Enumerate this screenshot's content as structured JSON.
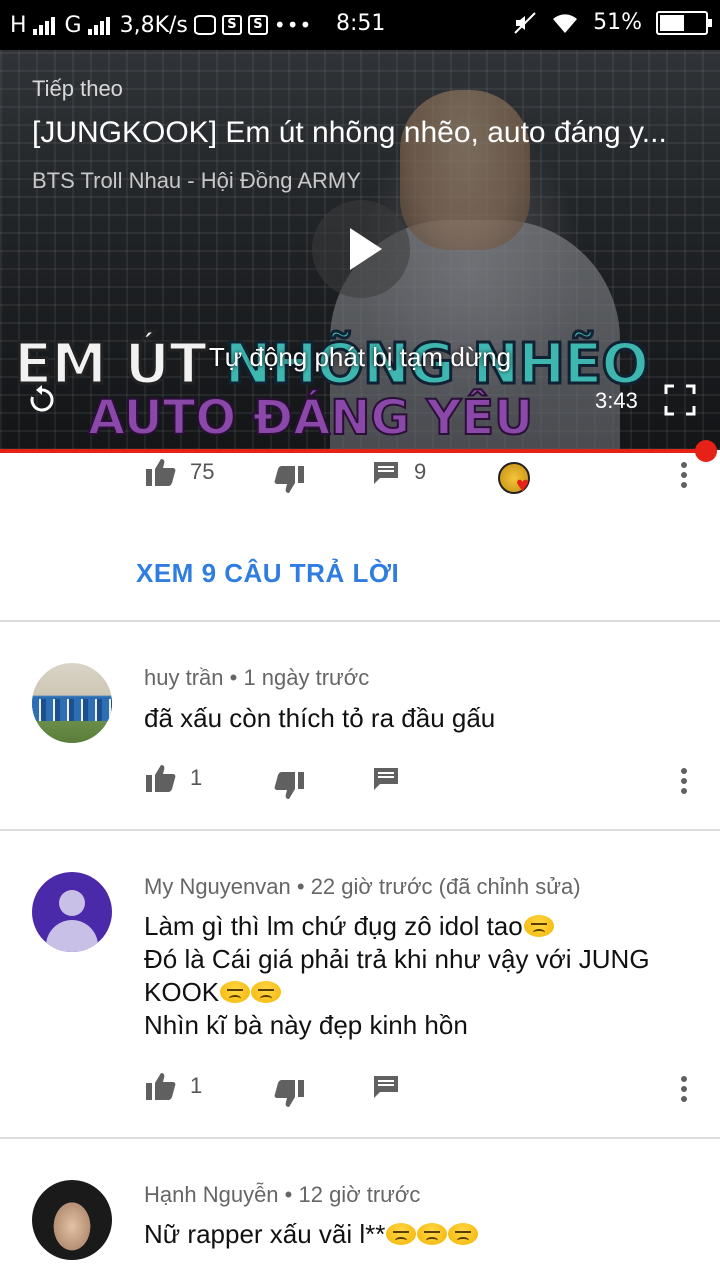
{
  "status_bar": {
    "network1": "H",
    "network2": "G",
    "speed": "3,8K/s",
    "time": "8:51",
    "battery": "51%"
  },
  "player": {
    "up_next_label": "Tiếp theo",
    "title": "[JUNGKOOK] Em út nhõng nhẽo, auto đáng y...",
    "channel": "BTS Troll Nhau - Hội Đồng ARMY",
    "thumb_line1_white": "EM ÚT ",
    "thumb_line1_green": "NHÕNG NHẼO",
    "thumb_line2": "AUTO ĐÁNG YÊU",
    "autoplay_message": "Tự động phát bị tạm dừng",
    "duration": "3:43",
    "progress": 0.98
  },
  "parent_actions": {
    "likes": "75",
    "replies": "9"
  },
  "view_replies_label": "XEM 9 CÂU TRẢ LỜI",
  "comments": [
    {
      "author": "huy trần",
      "time": "1 ngày trước",
      "lines": [
        "đã xấu còn thích tỏ ra đầu gấu"
      ],
      "likes": "1"
    },
    {
      "author": "My Nguyenvan",
      "time": "22 giờ trước (đã chỉnh sửa)",
      "lines": [
        "Làm gì thì lm chứ đụg zô idol tao",
        "Đó là Cái giá phải trả khi như vậy với JUNG",
        "KOOK",
        "Nhìn kĩ bà này đẹp kinh hồn"
      ],
      "likes": "1"
    },
    {
      "author": "Hạnh Nguyễn",
      "time": "12 giờ trước",
      "lines": [
        "Nữ rapper xấu vãi l**"
      ],
      "likes": ""
    }
  ],
  "colors": {
    "accent_blue": "#2f7de1",
    "progress_red": "#e62117",
    "icon_gray": "#606060"
  }
}
